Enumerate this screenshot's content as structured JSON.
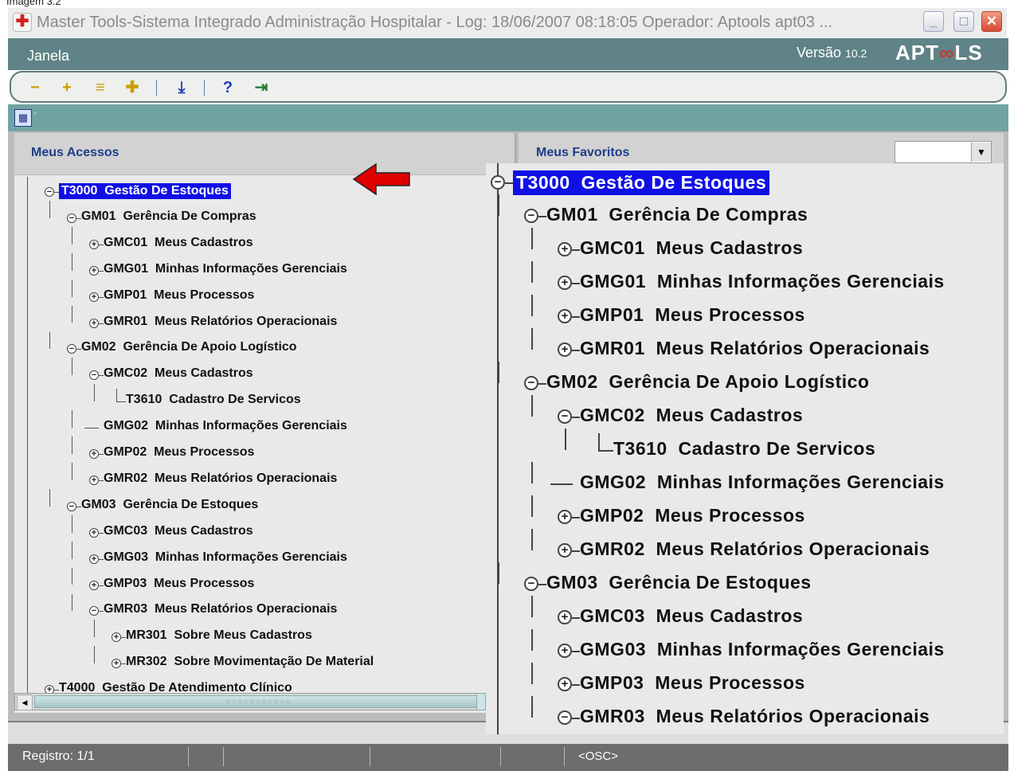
{
  "caption": "Imagem 3.2",
  "window": {
    "title": "Master Tools-Sistema Integrado Administração Hospitalar - Log: 18/06/2007 08:18:05 Operador: Aptools apt03 ...",
    "icon": "hospital-cross-icon"
  },
  "menu": {
    "janela": "Janela"
  },
  "version": {
    "label": "Versão",
    "number": "10.2"
  },
  "brand": "APTOOLS",
  "toolbar": {
    "icons": [
      "collapse-icon",
      "expand-icon",
      "collapse-all-icon",
      "expand-all-icon",
      "download-icon",
      "help-icon",
      "exit-door-icon"
    ],
    "glyphs": {
      "collapse": "−",
      "expand": "+",
      "collapse_all": "≡",
      "expand_all": "✚",
      "download": "⤓",
      "help": "?",
      "exit": "⇥"
    }
  },
  "subbar": {
    "dots": "·"
  },
  "panels": {
    "acessos": "Meus Acessos",
    "favoritos": "Meus Favoritos"
  },
  "tree": [
    {
      "code": "T3000",
      "label": "Gestão De Estoques",
      "level": 0,
      "toggle": "minus",
      "selected": true
    },
    {
      "code": "GM01",
      "label": "Gerência De Compras",
      "level": 1,
      "toggle": "minus"
    },
    {
      "code": "GMC01",
      "label": "Meus Cadastros",
      "level": 2,
      "toggle": "plus"
    },
    {
      "code": "GMG01",
      "label": "Minhas Informações Gerenciais",
      "level": 2,
      "toggle": "plus"
    },
    {
      "code": "GMP01",
      "label": "Meus Processos",
      "level": 2,
      "toggle": "plus"
    },
    {
      "code": "GMR01",
      "label": "Meus Relatórios Operacionais",
      "level": 2,
      "toggle": "plus"
    },
    {
      "code": "GM02",
      "label": "Gerência De Apoio Logístico",
      "level": 1,
      "toggle": "minus"
    },
    {
      "code": "GMC02",
      "label": "Meus Cadastros",
      "level": 2,
      "toggle": "minus"
    },
    {
      "code": "T3610",
      "label": "Cadastro De Servicos",
      "level": 3,
      "toggle": "leaf-corner"
    },
    {
      "code": "GMG02",
      "label": "Minhas Informações Gerenciais",
      "level": 2,
      "toggle": "leaf"
    },
    {
      "code": "GMP02",
      "label": "Meus Processos",
      "level": 2,
      "toggle": "plus"
    },
    {
      "code": "GMR02",
      "label": "Meus Relatórios Operacionais",
      "level": 2,
      "toggle": "plus"
    },
    {
      "code": "GM03",
      "label": "Gerência De Estoques",
      "level": 1,
      "toggle": "minus"
    },
    {
      "code": "GMC03",
      "label": "Meus Cadastros",
      "level": 2,
      "toggle": "plus"
    },
    {
      "code": "GMG03",
      "label": "Minhas Informações Gerenciais",
      "level": 2,
      "toggle": "plus"
    },
    {
      "code": "GMP03",
      "label": "Meus Processos",
      "level": 2,
      "toggle": "plus"
    },
    {
      "code": "GMR03",
      "label": "Meus Relatórios Operacionais",
      "level": 2,
      "toggle": "minus"
    },
    {
      "code": "MR301",
      "label": "Sobre Meus Cadastros",
      "level": 3,
      "toggle": "plus"
    },
    {
      "code": "MR302",
      "label": "Sobre Movimentação De Material",
      "level": 3,
      "toggle": "plus"
    },
    {
      "code": "T4000",
      "label": "Gestão De Atendimento Clínico",
      "level": 0,
      "toggle": "plus"
    }
  ],
  "zoom_count": 17,
  "status": {
    "registro": "Registro: 1/1",
    "osc": "<OSC>"
  },
  "colors": {
    "selection": "#1010e6",
    "menubar": "#5f8386",
    "arrow": "#e00000"
  }
}
